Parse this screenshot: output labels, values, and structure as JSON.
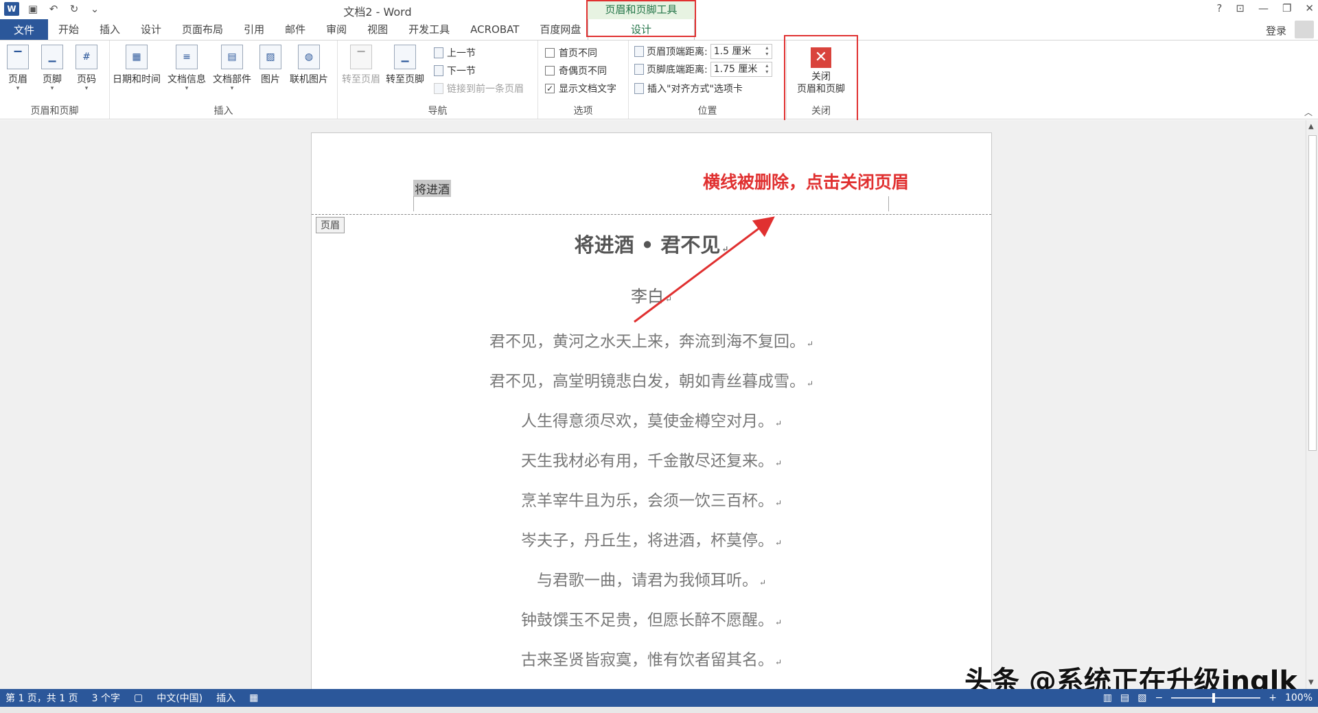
{
  "titlebar": {
    "doc_title": "文档2 - Word",
    "contextual_title": "页眉和页脚工具",
    "controls": [
      "?",
      "⊡",
      "—",
      "❐",
      "✕"
    ]
  },
  "tabs": {
    "file": "文件",
    "items": [
      "开始",
      "插入",
      "设计",
      "页面布局",
      "引用",
      "邮件",
      "审阅",
      "视图",
      "开发工具",
      "ACROBAT",
      "百度网盘"
    ],
    "contextual_design": "设计",
    "login": "登录"
  },
  "ribbon": {
    "group_header_footer": {
      "label": "页眉和页脚",
      "header": "页眉",
      "footer": "页脚",
      "page_number": "页码"
    },
    "group_insert": {
      "label": "插入",
      "date_time": "日期和时间",
      "doc_info": "文档信息",
      "quick_parts": "文档部件",
      "picture": "图片",
      "online_picture": "联机图片"
    },
    "group_nav": {
      "label": "导航",
      "goto_header": "转至页眉",
      "goto_footer": "转至页脚",
      "prev_section": "上一节",
      "next_section": "下一节",
      "link_previous": "链接到前一条页眉"
    },
    "group_options": {
      "label": "选项",
      "diff_first": "首页不同",
      "diff_odd_even": "奇偶页不同",
      "show_doc_text": "显示文档文字"
    },
    "group_position": {
      "label": "位置",
      "header_top_label": "页眉顶端距离:",
      "header_top_value": "1.5 厘米",
      "footer_bottom_label": "页脚底端距离:",
      "footer_bottom_value": "1.75 厘米",
      "insert_align_tab": "插入\"对齐方式\"选项卡"
    },
    "group_close": {
      "label": "关闭",
      "close_line1": "关闭",
      "close_line2": "页眉和页脚"
    }
  },
  "document": {
    "header_text": "将进酒",
    "header_tag": "页眉",
    "title": "将进酒 • 君不见",
    "author": "李白",
    "lines": [
      "君不见，黄河之水天上来，奔流到海不复回。",
      "君不见，高堂明镜悲白发，朝如青丝暮成雪。",
      "人生得意须尽欢，莫使金樽空对月。",
      "天生我材必有用，千金散尽还复来。",
      "烹羊宰牛且为乐，会须一饮三百杯。",
      "岑夫子，丹丘生，将进酒，杯莫停。",
      "与君歌一曲，请君为我倾耳听。",
      "钟鼓馔玉不足贵，但愿长醉不愿醒。",
      "古来圣贤皆寂寞，惟有饮者留其名。"
    ],
    "para_mark": "↵"
  },
  "annotation": "横线被删除，点击关闭页眉",
  "watermark": "头条 @系统正在升级inglk",
  "statusbar": {
    "page": "第 1 页，共 1 页",
    "words": "3 个字",
    "language": "中文(中国)",
    "mode": "插入",
    "zoom": "100%"
  },
  "colors": {
    "accent": "#2b579a",
    "contextual": "#217346",
    "highlight": "#e03030"
  }
}
